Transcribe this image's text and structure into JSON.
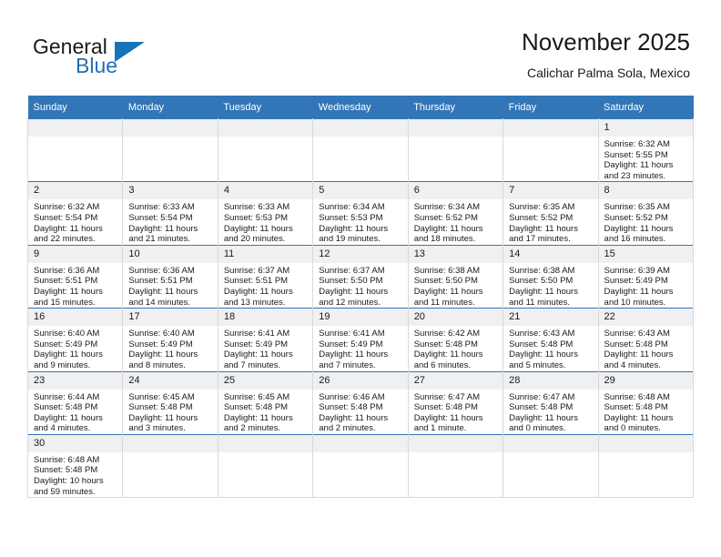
{
  "logo": {
    "word_one": "General",
    "word_two": "Blue",
    "triangle_color": "#1573ba",
    "blue_text_color": "#1f6fb5"
  },
  "header": {
    "title": "November 2025",
    "location": "Calichar Palma Sola, Mexico"
  },
  "theme": {
    "header_bg": "#3276b8",
    "daynum_bg": "#f0f0f0",
    "row_border": "#3276b8",
    "cell_border": "#d9d9d9",
    "text": "#1a1a1a"
  },
  "weekdays": [
    "Sunday",
    "Monday",
    "Tuesday",
    "Wednesday",
    "Thursday",
    "Friday",
    "Saturday"
  ],
  "weeks": [
    [
      {
        "day": "",
        "lines": []
      },
      {
        "day": "",
        "lines": []
      },
      {
        "day": "",
        "lines": []
      },
      {
        "day": "",
        "lines": []
      },
      {
        "day": "",
        "lines": []
      },
      {
        "day": "",
        "lines": []
      },
      {
        "day": "1",
        "lines": [
          "Sunrise: 6:32 AM",
          "Sunset: 5:55 PM",
          "Daylight: 11 hours",
          "and 23 minutes."
        ]
      }
    ],
    [
      {
        "day": "2",
        "lines": [
          "Sunrise: 6:32 AM",
          "Sunset: 5:54 PM",
          "Daylight: 11 hours",
          "and 22 minutes."
        ]
      },
      {
        "day": "3",
        "lines": [
          "Sunrise: 6:33 AM",
          "Sunset: 5:54 PM",
          "Daylight: 11 hours",
          "and 21 minutes."
        ]
      },
      {
        "day": "4",
        "lines": [
          "Sunrise: 6:33 AM",
          "Sunset: 5:53 PM",
          "Daylight: 11 hours",
          "and 20 minutes."
        ]
      },
      {
        "day": "5",
        "lines": [
          "Sunrise: 6:34 AM",
          "Sunset: 5:53 PM",
          "Daylight: 11 hours",
          "and 19 minutes."
        ]
      },
      {
        "day": "6",
        "lines": [
          "Sunrise: 6:34 AM",
          "Sunset: 5:52 PM",
          "Daylight: 11 hours",
          "and 18 minutes."
        ]
      },
      {
        "day": "7",
        "lines": [
          "Sunrise: 6:35 AM",
          "Sunset: 5:52 PM",
          "Daylight: 11 hours",
          "and 17 minutes."
        ]
      },
      {
        "day": "8",
        "lines": [
          "Sunrise: 6:35 AM",
          "Sunset: 5:52 PM",
          "Daylight: 11 hours",
          "and 16 minutes."
        ]
      }
    ],
    [
      {
        "day": "9",
        "lines": [
          "Sunrise: 6:36 AM",
          "Sunset: 5:51 PM",
          "Daylight: 11 hours",
          "and 15 minutes."
        ]
      },
      {
        "day": "10",
        "lines": [
          "Sunrise: 6:36 AM",
          "Sunset: 5:51 PM",
          "Daylight: 11 hours",
          "and 14 minutes."
        ]
      },
      {
        "day": "11",
        "lines": [
          "Sunrise: 6:37 AM",
          "Sunset: 5:51 PM",
          "Daylight: 11 hours",
          "and 13 minutes."
        ]
      },
      {
        "day": "12",
        "lines": [
          "Sunrise: 6:37 AM",
          "Sunset: 5:50 PM",
          "Daylight: 11 hours",
          "and 12 minutes."
        ]
      },
      {
        "day": "13",
        "lines": [
          "Sunrise: 6:38 AM",
          "Sunset: 5:50 PM",
          "Daylight: 11 hours",
          "and 11 minutes."
        ]
      },
      {
        "day": "14",
        "lines": [
          "Sunrise: 6:38 AM",
          "Sunset: 5:50 PM",
          "Daylight: 11 hours",
          "and 11 minutes."
        ]
      },
      {
        "day": "15",
        "lines": [
          "Sunrise: 6:39 AM",
          "Sunset: 5:49 PM",
          "Daylight: 11 hours",
          "and 10 minutes."
        ]
      }
    ],
    [
      {
        "day": "16",
        "lines": [
          "Sunrise: 6:40 AM",
          "Sunset: 5:49 PM",
          "Daylight: 11 hours",
          "and 9 minutes."
        ]
      },
      {
        "day": "17",
        "lines": [
          "Sunrise: 6:40 AM",
          "Sunset: 5:49 PM",
          "Daylight: 11 hours",
          "and 8 minutes."
        ]
      },
      {
        "day": "18",
        "lines": [
          "Sunrise: 6:41 AM",
          "Sunset: 5:49 PM",
          "Daylight: 11 hours",
          "and 7 minutes."
        ]
      },
      {
        "day": "19",
        "lines": [
          "Sunrise: 6:41 AM",
          "Sunset: 5:49 PM",
          "Daylight: 11 hours",
          "and 7 minutes."
        ]
      },
      {
        "day": "20",
        "lines": [
          "Sunrise: 6:42 AM",
          "Sunset: 5:48 PM",
          "Daylight: 11 hours",
          "and 6 minutes."
        ]
      },
      {
        "day": "21",
        "lines": [
          "Sunrise: 6:43 AM",
          "Sunset: 5:48 PM",
          "Daylight: 11 hours",
          "and 5 minutes."
        ]
      },
      {
        "day": "22",
        "lines": [
          "Sunrise: 6:43 AM",
          "Sunset: 5:48 PM",
          "Daylight: 11 hours",
          "and 4 minutes."
        ]
      }
    ],
    [
      {
        "day": "23",
        "lines": [
          "Sunrise: 6:44 AM",
          "Sunset: 5:48 PM",
          "Daylight: 11 hours",
          "and 4 minutes."
        ]
      },
      {
        "day": "24",
        "lines": [
          "Sunrise: 6:45 AM",
          "Sunset: 5:48 PM",
          "Daylight: 11 hours",
          "and 3 minutes."
        ]
      },
      {
        "day": "25",
        "lines": [
          "Sunrise: 6:45 AM",
          "Sunset: 5:48 PM",
          "Daylight: 11 hours",
          "and 2 minutes."
        ]
      },
      {
        "day": "26",
        "lines": [
          "Sunrise: 6:46 AM",
          "Sunset: 5:48 PM",
          "Daylight: 11 hours",
          "and 2 minutes."
        ]
      },
      {
        "day": "27",
        "lines": [
          "Sunrise: 6:47 AM",
          "Sunset: 5:48 PM",
          "Daylight: 11 hours",
          "and 1 minute."
        ]
      },
      {
        "day": "28",
        "lines": [
          "Sunrise: 6:47 AM",
          "Sunset: 5:48 PM",
          "Daylight: 11 hours",
          "and 0 minutes."
        ]
      },
      {
        "day": "29",
        "lines": [
          "Sunrise: 6:48 AM",
          "Sunset: 5:48 PM",
          "Daylight: 11 hours",
          "and 0 minutes."
        ]
      }
    ],
    [
      {
        "day": "30",
        "lines": [
          "Sunrise: 6:48 AM",
          "Sunset: 5:48 PM",
          "Daylight: 10 hours",
          "and 59 minutes."
        ]
      },
      {
        "day": "",
        "lines": []
      },
      {
        "day": "",
        "lines": []
      },
      {
        "day": "",
        "lines": []
      },
      {
        "day": "",
        "lines": []
      },
      {
        "day": "",
        "lines": []
      },
      {
        "day": "",
        "lines": []
      }
    ]
  ]
}
